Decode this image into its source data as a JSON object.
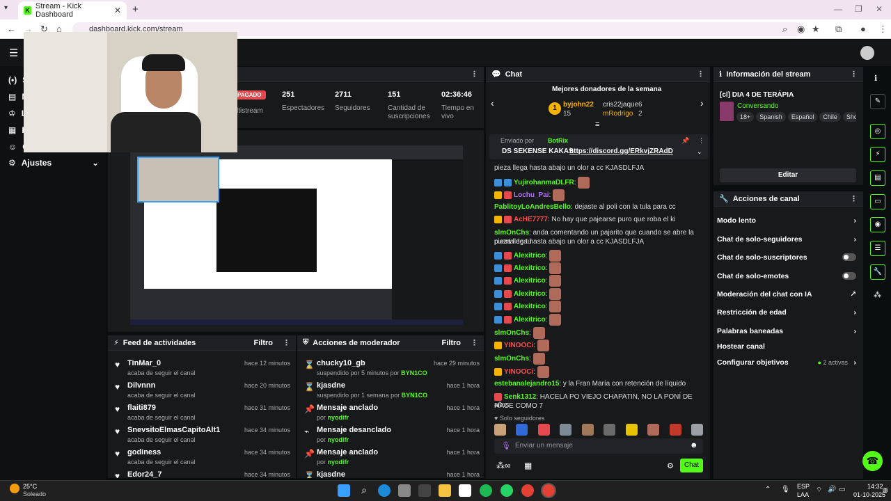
{
  "browser": {
    "tab_title": "Stream - Kick Dashboard",
    "url": "dashboard.kick.com/stream"
  },
  "sidebar": {
    "items": [
      {
        "label": "S"
      },
      {
        "label": "M"
      },
      {
        "label": "L"
      },
      {
        "label": "E"
      },
      {
        "label": "C"
      }
    ],
    "settings_label": "Ajustes"
  },
  "stream_stats": {
    "status": "PAGADO",
    "multistream": "ltistream",
    "viewers_value": "251",
    "viewers_label": "Espectadores",
    "followers_value": "2711",
    "followers_label": "Seguidores",
    "subs_value": "151",
    "subs_label": "Cantidad de suscripciones",
    "time_value": "02:36:46",
    "time_label": "Tiempo en vivo"
  },
  "activity_feed": {
    "title": "Feed de actividades",
    "filter": "Filtro",
    "items": [
      {
        "name": "TinMar_0",
        "sub": "acaba de seguir el canal",
        "time": "hace 12 minutos"
      },
      {
        "name": "Dilvnnn",
        "sub": "acaba de seguir el canal",
        "time": "hace 20 minutos"
      },
      {
        "name": "flaiti879",
        "sub": "acaba de seguir el canal",
        "time": "hace 31 minutos"
      },
      {
        "name": "SnevsitoElmasCapitoAlt1",
        "sub": "acaba de seguir el canal",
        "time": "hace 34 minutos"
      },
      {
        "name": "godiness",
        "sub": "acaba de seguir el canal",
        "time": "hace 34 minutos"
      },
      {
        "name": "Edor24_7",
        "sub": "",
        "time": "hace 34 minutos"
      }
    ]
  },
  "mod_actions": {
    "title": "Acciones de moderador",
    "filter": "Filtro",
    "items": [
      {
        "name": "chucky10_gb",
        "sub": "suspendido por 5 minutos por",
        "by": "BYN1CO",
        "time": "hace 29 minutos"
      },
      {
        "name": "kjasdne",
        "sub": "suspendido por 1 semana por",
        "by": "BYN1CO",
        "time": "hace 1 hora"
      },
      {
        "name": "Mensaje anclado",
        "sub": "por",
        "by": "nyodifr",
        "time": "hace 1 hora"
      },
      {
        "name": "Mensaje desanclado",
        "sub": "por",
        "by": "nyodifr",
        "time": "hace 1 hora"
      },
      {
        "name": "Mensaje anclado",
        "sub": "por",
        "by": "nyodifr",
        "time": "hace 1 hora"
      },
      {
        "name": "kjasdne",
        "sub": "",
        "by": "",
        "time": "hace 1 hora"
      }
    ]
  },
  "chat": {
    "title": "Chat",
    "donors_title": "Mejores donadores de la semana",
    "donors": [
      {
        "rank": "1",
        "name": "byjohn22",
        "count": "15"
      },
      {
        "name": "cris22jaque",
        "count": "6"
      },
      {
        "name": "mRodrigo",
        "count": "2"
      }
    ],
    "pinned_sent_by": "Enviado por",
    "pinned_bot": "BotRix",
    "pinned_text": "DS SEKENSE KAKAS",
    "pinned_link": "https://discord.gg/ERkvjZRAdD",
    "lines": [
      {
        "user": "",
        "text": "pieza llega hasta abajo un olor a cc KJASDLFJA",
        "color": "#ddd"
      },
      {
        "user": "YujirohanmaDLFR",
        "text": ":",
        "color": "#53fc18"
      },
      {
        "user": "Lochu_Pai",
        "text": ":",
        "color": "#b070ff"
      },
      {
        "user": "PablitoyLoAndresBello",
        "text": ": dejaste al poli con la tula para cc",
        "color": "#53fc18"
      },
      {
        "user": "AcHE7777",
        "text": ": No hay que pajearse puro que roba el ki",
        "color": "#ff4d4d"
      },
      {
        "user": "slmOnChs",
        "text": ": anda comentando un pajarito que cuando se abre la puerta de tu",
        "color": "#53fc18"
      },
      {
        "user": "",
        "text": "pieza llega hasta abajo un olor a cc KJASDLFJA",
        "color": "#ddd"
      },
      {
        "user": "Alexitrico",
        "text": ":",
        "color": "#53fc18"
      },
      {
        "user": "Alexitrico",
        "text": ":",
        "color": "#53fc18"
      },
      {
        "user": "Alexitrico",
        "text": ":",
        "color": "#53fc18"
      },
      {
        "user": "Alexitrico",
        "text": ":",
        "color": "#53fc18"
      },
      {
        "user": "Alexitrico",
        "text": ":",
        "color": "#53fc18"
      },
      {
        "user": "Alexitrico",
        "text": ":",
        "color": "#53fc18"
      },
      {
        "user": "slmOnChs",
        "text": ":",
        "color": "#53fc18"
      },
      {
        "user": "YINOOCi",
        "text": ":",
        "color": "#ff4d4d"
      },
      {
        "user": "slmOnChs",
        "text": ":",
        "color": "#53fc18"
      },
      {
        "user": "YINOOCi",
        "text": ":",
        "color": "#ff4d4d"
      },
      {
        "user": "estebanalejandro15",
        "text": ": y la Fran María con retención de líquido",
        "color": "#53fc18"
      },
      {
        "user": "Senk1312",
        "text": ": HACELA PO VIEJO CHAPATIN, NO LA PONÍ DE HACE COMO 7",
        "color": "#53fc18"
      },
      {
        "user": "",
        "text": "años",
        "color": "#ddd"
      }
    ],
    "followers_only": "Solo seguidores",
    "input_placeholder": "Enviar un mensaje",
    "send_label": "Chat"
  },
  "stream_info": {
    "title": "Información del stream",
    "stream_title": "[cl] DIA 4 DE TERÁPIA",
    "category": "Conversando",
    "tags": [
      "18+",
      "Spanish",
      "Español",
      "Chile",
      "Shoote"
    ],
    "edit_label": "Editar"
  },
  "channel_actions": {
    "title": "Acciones de canal",
    "items": [
      {
        "label": "Modo lento",
        "control": "arrow"
      },
      {
        "label": "Chat de solo-seguidores",
        "control": "arrow"
      },
      {
        "label": "Chat de solo-suscriptores",
        "control": "toggle"
      },
      {
        "label": "Chat de solo-emotes",
        "control": "toggle"
      },
      {
        "label": "Moderación del chat con IA",
        "control": "external"
      },
      {
        "label": "Restricción de edad",
        "control": "arrow"
      },
      {
        "label": "Palabras baneadas",
        "control": "arrow"
      },
      {
        "label": "Hostear canal",
        "control": "none"
      },
      {
        "label": "Configurar objetivos",
        "control": "arrow"
      }
    ],
    "goals_active": "2 activas"
  },
  "taskbar": {
    "weather_temp": "25°C",
    "weather_desc": "Soleado",
    "lang": "ESP",
    "lang2": "LAA",
    "time": "14:32",
    "date": "01-10-2025"
  },
  "colors": {
    "accent": "#53fc18",
    "panel": "#18191b",
    "background": "#0b0e0f"
  }
}
